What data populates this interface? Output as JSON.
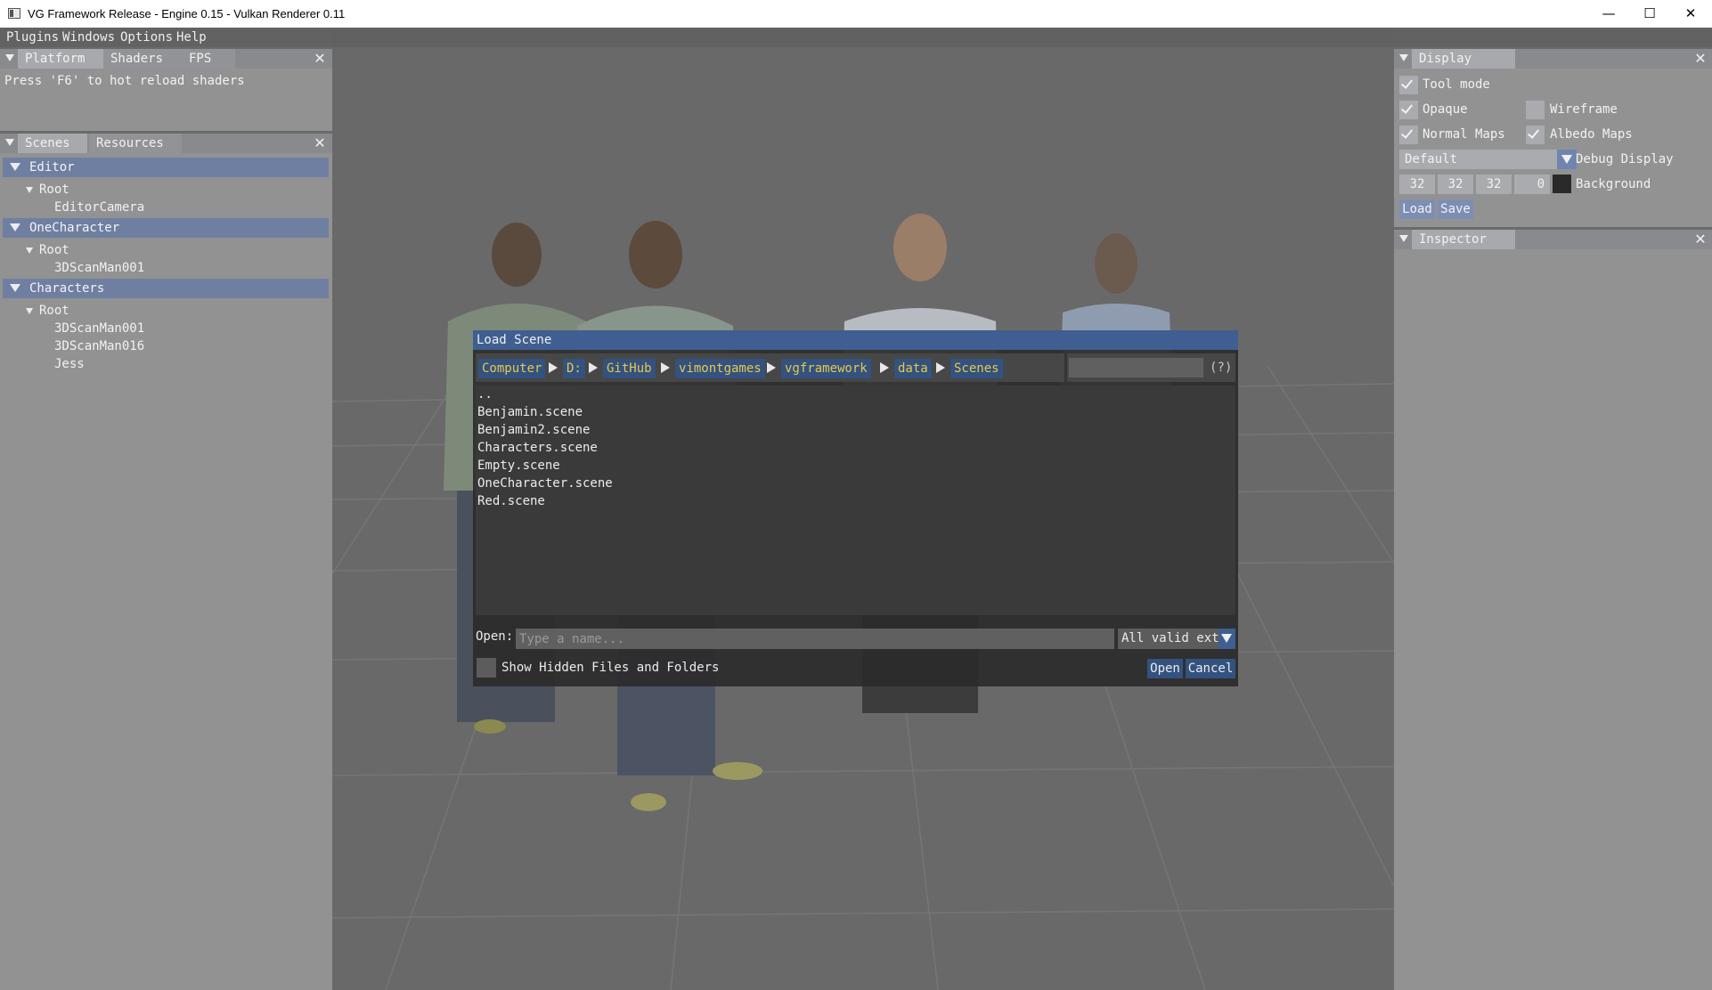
{
  "window": {
    "title": "VG Framework Release - Engine 0.15 - Vulkan Renderer 0.11",
    "minimize_glyph": "—",
    "maximize_glyph": "☐",
    "close_glyph": "✕"
  },
  "menu": {
    "items": [
      "Plugins",
      "Windows",
      "Options",
      "Help"
    ]
  },
  "platform_panel": {
    "tabs": [
      "Platform",
      "Shaders",
      "FPS"
    ],
    "message": "Press 'F6' to hot reload shaders",
    "close_glyph": "✕"
  },
  "scenes_panel": {
    "tabs": [
      "Scenes",
      "Resources"
    ],
    "close_glyph": "✕",
    "groups": [
      {
        "name": "Editor",
        "root": "Root",
        "children": [
          "EditorCamera"
        ]
      },
      {
        "name": "OneCharacter",
        "root": "Root",
        "children": [
          "3DScanMan001"
        ]
      },
      {
        "name": "Characters",
        "root": "Root",
        "children": [
          "3DScanMan001",
          "3DScanMan016",
          "Jess"
        ]
      }
    ]
  },
  "display_panel": {
    "title": "Display",
    "close_glyph": "✕",
    "tool_mode": {
      "label": "Tool mode",
      "checked": true
    },
    "opaque": {
      "label": "Opaque",
      "checked": true
    },
    "wireframe": {
      "label": "Wireframe",
      "checked": false
    },
    "normal_maps": {
      "label": "Normal Maps",
      "checked": true
    },
    "albedo_maps": {
      "label": "Albedo Maps",
      "checked": true
    },
    "debug_display": {
      "value": "Default",
      "label": "Debug Display"
    },
    "background": {
      "r": "32",
      "g": "32",
      "b": "32",
      "a": "0",
      "label": "Background"
    },
    "load_label": "Load",
    "save_label": "Save"
  },
  "inspector_panel": {
    "title": "Inspector",
    "close_glyph": "✕"
  },
  "load_dialog": {
    "title": "Load Scene",
    "path": [
      "Computer",
      "D:",
      "GitHub",
      "vimontgames",
      "vgframework",
      "data",
      "Scenes"
    ],
    "help": "(?)",
    "files": [
      "..",
      "Benjamin.scene",
      "Benjamin2.scene",
      "Characters.scene",
      "Empty.scene",
      "OneCharacter.scene",
      "Red.scene"
    ],
    "open_label": "Open:",
    "name_placeholder": "Type a name...",
    "filter_value": "All valid ext",
    "show_hidden_label": "Show Hidden Files and Folders",
    "show_hidden_checked": false,
    "open_button": "Open",
    "cancel_button": "Cancel"
  }
}
